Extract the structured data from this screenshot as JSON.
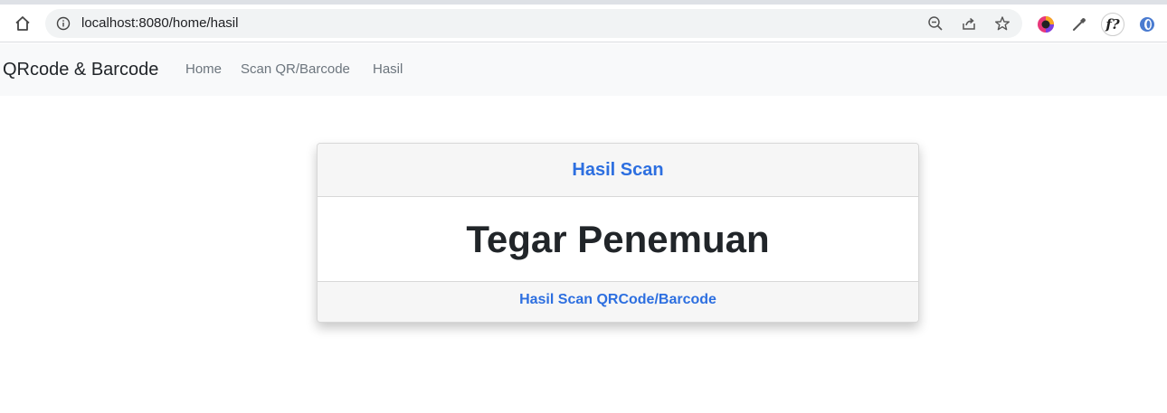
{
  "browser": {
    "url": "localhost:8080/home/hasil",
    "icons": {
      "home": "home-icon",
      "info": "info-icon",
      "zoom": "zoom-out-icon",
      "share": "share-icon",
      "bookmark": "star-icon",
      "extension_1": "color-circle-icon",
      "extension_2": "eyedropper-icon",
      "extension_3_label": "f?",
      "extension_4": "circle-extension-icon"
    }
  },
  "navbar": {
    "brand": "QRcode & Barcode",
    "links": [
      {
        "label": "Home"
      },
      {
        "label": "Scan QR/Barcode"
      },
      {
        "label": "Hasil"
      }
    ]
  },
  "card": {
    "header": "Hasil Scan",
    "body": "Tegar Penemuan",
    "footer_link": "Hasil Scan QRCode/Barcode"
  },
  "colors": {
    "accent": "#2d6fe0",
    "navbar_bg": "#f8f9fa",
    "nav_link": "#6c757d",
    "text_dark": "#212529"
  }
}
